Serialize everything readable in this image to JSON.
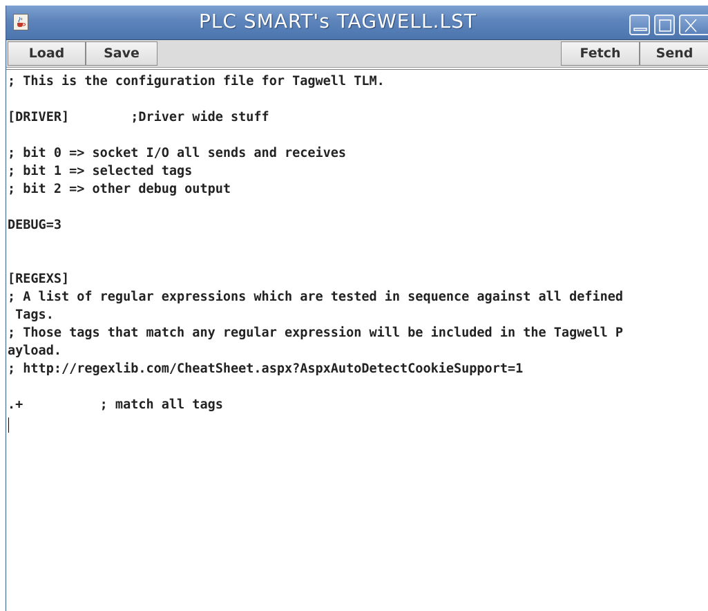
{
  "window": {
    "title": "PLC SMART's TAGWELL.LST"
  },
  "icons": {
    "app": "java-cup-icon",
    "minimize": "minimize-icon",
    "maximize": "maximize-icon",
    "close": "close-icon"
  },
  "toolbar": {
    "load_label": "Load",
    "save_label": "Save",
    "fetch_label": "Fetch",
    "send_label": "Send"
  },
  "editor": {
    "content": "; This is the configuration file for Tagwell TLM.\n\n[DRIVER]        ;Driver wide stuff\n\n; bit 0 => socket I/O all sends and receives\n; bit 1 => selected tags\n; bit 2 => other debug output\n\nDEBUG=3\n\n\n[REGEXS]\n; A list of regular expressions which are tested in sequence against all defined\n Tags.\n; Those tags that match any regular expression will be included in the Tagwell P\nayload.\n; http://regexlib.com/CheatSheet.aspx?AspxAutoDetectCookieSupport=1\n\n.+          ; match all tags\n"
  },
  "colors": {
    "titlebar": "#5d84bb",
    "title_text": "#ffffff",
    "toolbar_bg": "#dcdcdc",
    "editor_bg": "#ffffff"
  }
}
